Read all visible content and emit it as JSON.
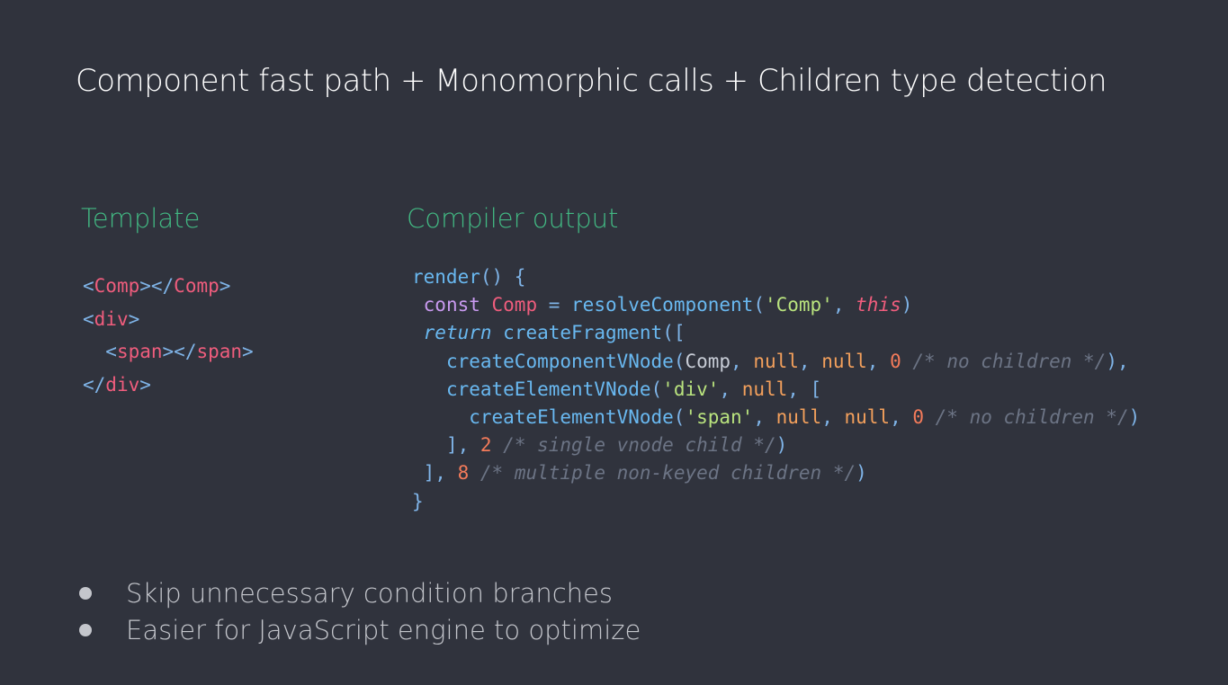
{
  "slide": {
    "title": "Component fast path + Monomorphic calls + Children type detection",
    "template_label": "Template",
    "compiler_label": "Compiler output"
  },
  "template_code": [
    [
      [
        "punct",
        "<"
      ],
      [
        "tag",
        "Comp"
      ],
      [
        "punct",
        "></"
      ],
      [
        "tag",
        "Comp"
      ],
      [
        "punct",
        ">"
      ]
    ],
    [
      [
        "punct",
        "<"
      ],
      [
        "tag",
        "div"
      ],
      [
        "punct",
        ">"
      ]
    ],
    [
      [
        "plain",
        "  "
      ],
      [
        "punct",
        "<"
      ],
      [
        "tag",
        "span"
      ],
      [
        "punct",
        "></"
      ],
      [
        "tag",
        "span"
      ],
      [
        "punct",
        ">"
      ]
    ],
    [
      [
        "punct",
        "</"
      ],
      [
        "tag",
        "div"
      ],
      [
        "punct",
        ">"
      ]
    ]
  ],
  "compiler_code": [
    [
      [
        "fn",
        "render"
      ],
      [
        "punct",
        "() {"
      ]
    ],
    [
      [
        "plain",
        " "
      ],
      [
        "keyword",
        "const "
      ],
      [
        "var",
        "Comp"
      ],
      [
        "punct",
        " = "
      ],
      [
        "fn",
        "resolveComponent"
      ],
      [
        "punct",
        "("
      ],
      [
        "string",
        "'Comp'"
      ],
      [
        "punct",
        ", "
      ],
      [
        "this",
        "this"
      ],
      [
        "punct",
        ")"
      ]
    ],
    [
      [
        "plain",
        " "
      ],
      [
        "return",
        "return "
      ],
      [
        "fn",
        "createFragment"
      ],
      [
        "punct",
        "(["
      ]
    ],
    [
      [
        "plain",
        "   "
      ],
      [
        "fn",
        "createComponentVNode"
      ],
      [
        "punct",
        "("
      ],
      [
        "plain",
        "Comp"
      ],
      [
        "punct",
        ", "
      ],
      [
        "null",
        "null"
      ],
      [
        "punct",
        ", "
      ],
      [
        "null",
        "null"
      ],
      [
        "punct",
        ", "
      ],
      [
        "number",
        "0 "
      ],
      [
        "comment",
        "/* no children */"
      ],
      [
        "punct",
        "),"
      ]
    ],
    [
      [
        "plain",
        "   "
      ],
      [
        "fn",
        "createElementVNode"
      ],
      [
        "punct",
        "("
      ],
      [
        "string",
        "'div'"
      ],
      [
        "punct",
        ", "
      ],
      [
        "null",
        "null"
      ],
      [
        "punct",
        ", ["
      ]
    ],
    [
      [
        "plain",
        "     "
      ],
      [
        "fn",
        "createElementVNode"
      ],
      [
        "punct",
        "("
      ],
      [
        "string",
        "'span'"
      ],
      [
        "punct",
        ", "
      ],
      [
        "null",
        "null"
      ],
      [
        "punct",
        ", "
      ],
      [
        "null",
        "null"
      ],
      [
        "punct",
        ", "
      ],
      [
        "number",
        "0 "
      ],
      [
        "comment",
        "/* no children */"
      ],
      [
        "punct",
        ")"
      ]
    ],
    [
      [
        "plain",
        "   "
      ],
      [
        "punct",
        "], "
      ],
      [
        "number",
        "2 "
      ],
      [
        "comment",
        "/* single vnode child */"
      ],
      [
        "punct",
        ")"
      ]
    ],
    [
      [
        "plain",
        " "
      ],
      [
        "punct",
        "], "
      ],
      [
        "number",
        "8 "
      ],
      [
        "comment",
        "/* multiple non-keyed children */"
      ],
      [
        "punct",
        ")"
      ]
    ],
    [
      [
        "punct",
        "}"
      ]
    ]
  ],
  "bullets": [
    "Skip unnecessary condition branches",
    "Easier for JavaScript engine to optimize"
  ]
}
